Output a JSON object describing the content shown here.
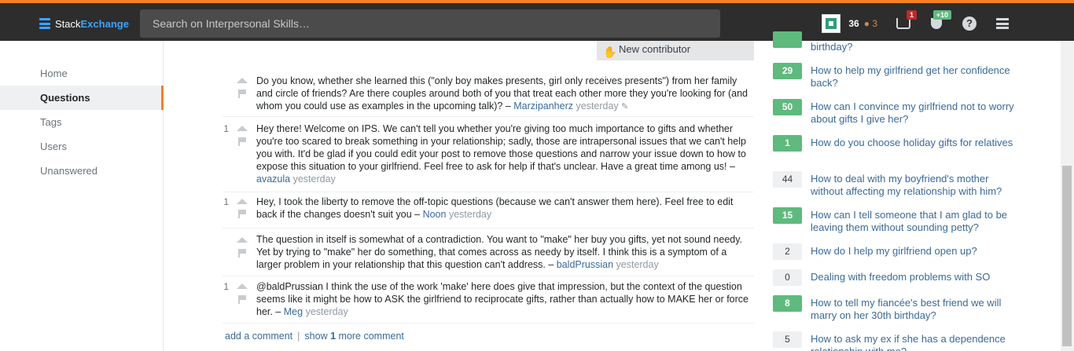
{
  "topbar": {
    "logo_prefix": "Stack",
    "logo_suffix": "Exchange",
    "search_placeholder": "Search on Interpersonal Skills…",
    "reputation": "36",
    "bronze_badges": "● 3",
    "inbox_count": "1",
    "achievements_count": "+10",
    "help_glyph": "?",
    "colors": {
      "background": "#2d2d2d",
      "accent": "#f48024",
      "counter_red": "#c0282a",
      "counter_green": "#5eba7d"
    }
  },
  "leftnav": {
    "items": [
      {
        "label": "Home"
      },
      {
        "label": "Questions",
        "active": true
      },
      {
        "label": "Tags"
      },
      {
        "label": "Users"
      },
      {
        "label": "Unanswered"
      }
    ]
  },
  "new_contributor_label": "New contributor",
  "comments": [
    {
      "score": "",
      "text": "Do you know, whether she learned this (\"only boy makes presents, girl only receives presents\") from her family and circle of friends? Are there couples around both of you that treat each other more they you're looking for (and whom you could use as examples in the upcoming talk)? – ",
      "user": "Marzipanherz",
      "date": "yesterday",
      "edited": true
    },
    {
      "score": "1",
      "text": "Hey there! Welcome on IPS. We can't tell you whether you're giving too much importance to gifts and whether you're too scared to break something in your relationship; sadly, those are intrapersonal issues that we can't help you with. It'd be glad if you could edit your post to remove those questions and narrow your issue down to how to expose this situation to your girlfriend. Feel free to ask for help if that's unclear. Have a great time among us! – ",
      "user": "avazula",
      "date": "yesterday"
    },
    {
      "score": "1",
      "text": "Hey, I took the liberty to remove the off-topic questions (because we can't answer them here). Feel free to edit back if the changes doesn't suit you – ",
      "user": "Noon",
      "date": "yesterday"
    },
    {
      "score": "",
      "text": "The question in itself is somewhat of a contradiction. You want to \"make\" her buy you gifts, yet not sound needy. Yet by trying to \"make\" her do something, that comes across as needy by itself. I think this is a symptom of a larger problem in your relationship that this question can't address. – ",
      "user": "baldPrussian",
      "date": "yesterday"
    },
    {
      "score": "1",
      "text": "@baldPrussian I think the use of the work 'make' here does give that impression, but the context of the question seems like it might be how to ASK the girlfriend to reciprocate gifts, rather than actually how to MAKE her or force her. – ",
      "user": "Meg",
      "date": "yesterday"
    }
  ],
  "comment_actions": {
    "add_label": "add a comment",
    "separator": "|",
    "show_prefix": "show",
    "show_count": "1",
    "show_suffix": "more comment"
  },
  "related": [
    {
      "score": "",
      "title": "birthday?",
      "style": "green"
    },
    {
      "score": "29",
      "title": "How to help my girlfriend get her confidence back?",
      "style": "green"
    },
    {
      "score": "50",
      "title": "How can I convince my girlfriend not to worry about gifts I give her?",
      "style": "green"
    },
    {
      "score": "1",
      "title": "How do you choose holiday gifts for relatives",
      "style": "green"
    },
    {
      "score": "44",
      "title": "How to deal with my boyfriend's mother without affecting my relationship with him?",
      "style": "plain"
    },
    {
      "score": "15",
      "title": "How can I tell someone that I am glad to be leaving them without sounding petty?",
      "style": "green"
    },
    {
      "score": "2",
      "title": "How do I help my girlfriend open up?",
      "style": "plain"
    },
    {
      "score": "0",
      "title": "Dealing with freedom problems with SO",
      "style": "plain"
    },
    {
      "score": "8",
      "title": "How to tell my fiancée's best friend we will marry on her 30th birthday?",
      "style": "green"
    },
    {
      "score": "5",
      "title": "How to ask my ex if she has a dependence relationship with me?",
      "style": "plain"
    }
  ]
}
